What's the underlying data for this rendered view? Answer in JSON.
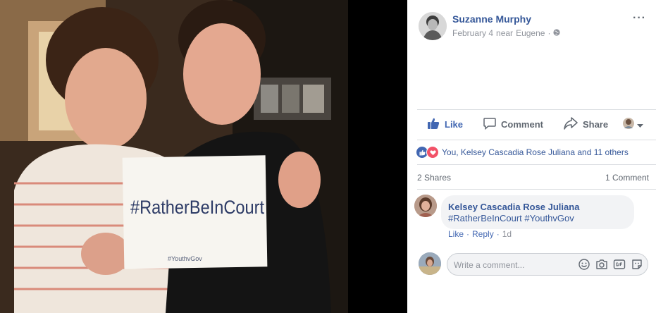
{
  "post": {
    "author": "Suzanne Murphy",
    "date": "February 4",
    "location_prefix": "near",
    "location": "Eugene",
    "dot": "·",
    "more": "···"
  },
  "actions": {
    "like": "Like",
    "comment": "Comment",
    "share": "Share"
  },
  "reactions": {
    "summary": "You, Kelsey Cascadia Rose Juliana and 11 others"
  },
  "counts": {
    "shares": "2 Shares",
    "comments": "1 Comment"
  },
  "comment": {
    "author": "Kelsey Cascadia Rose Juliana",
    "hashtag1": "#RatherBeInCourt",
    "hashtag2": "#YouthvGov",
    "like": "Like",
    "reply": "Reply",
    "dot": "·",
    "time": "1d"
  },
  "composer": {
    "placeholder": "Write a comment..."
  },
  "photo": {
    "sign_main": "#RatherBeInCourt",
    "sign_small": "#YouthvGov"
  },
  "colors": {
    "link": "#365899",
    "like_blue": "#4267b2",
    "gray": "#606770",
    "love_red": "#f25268"
  }
}
